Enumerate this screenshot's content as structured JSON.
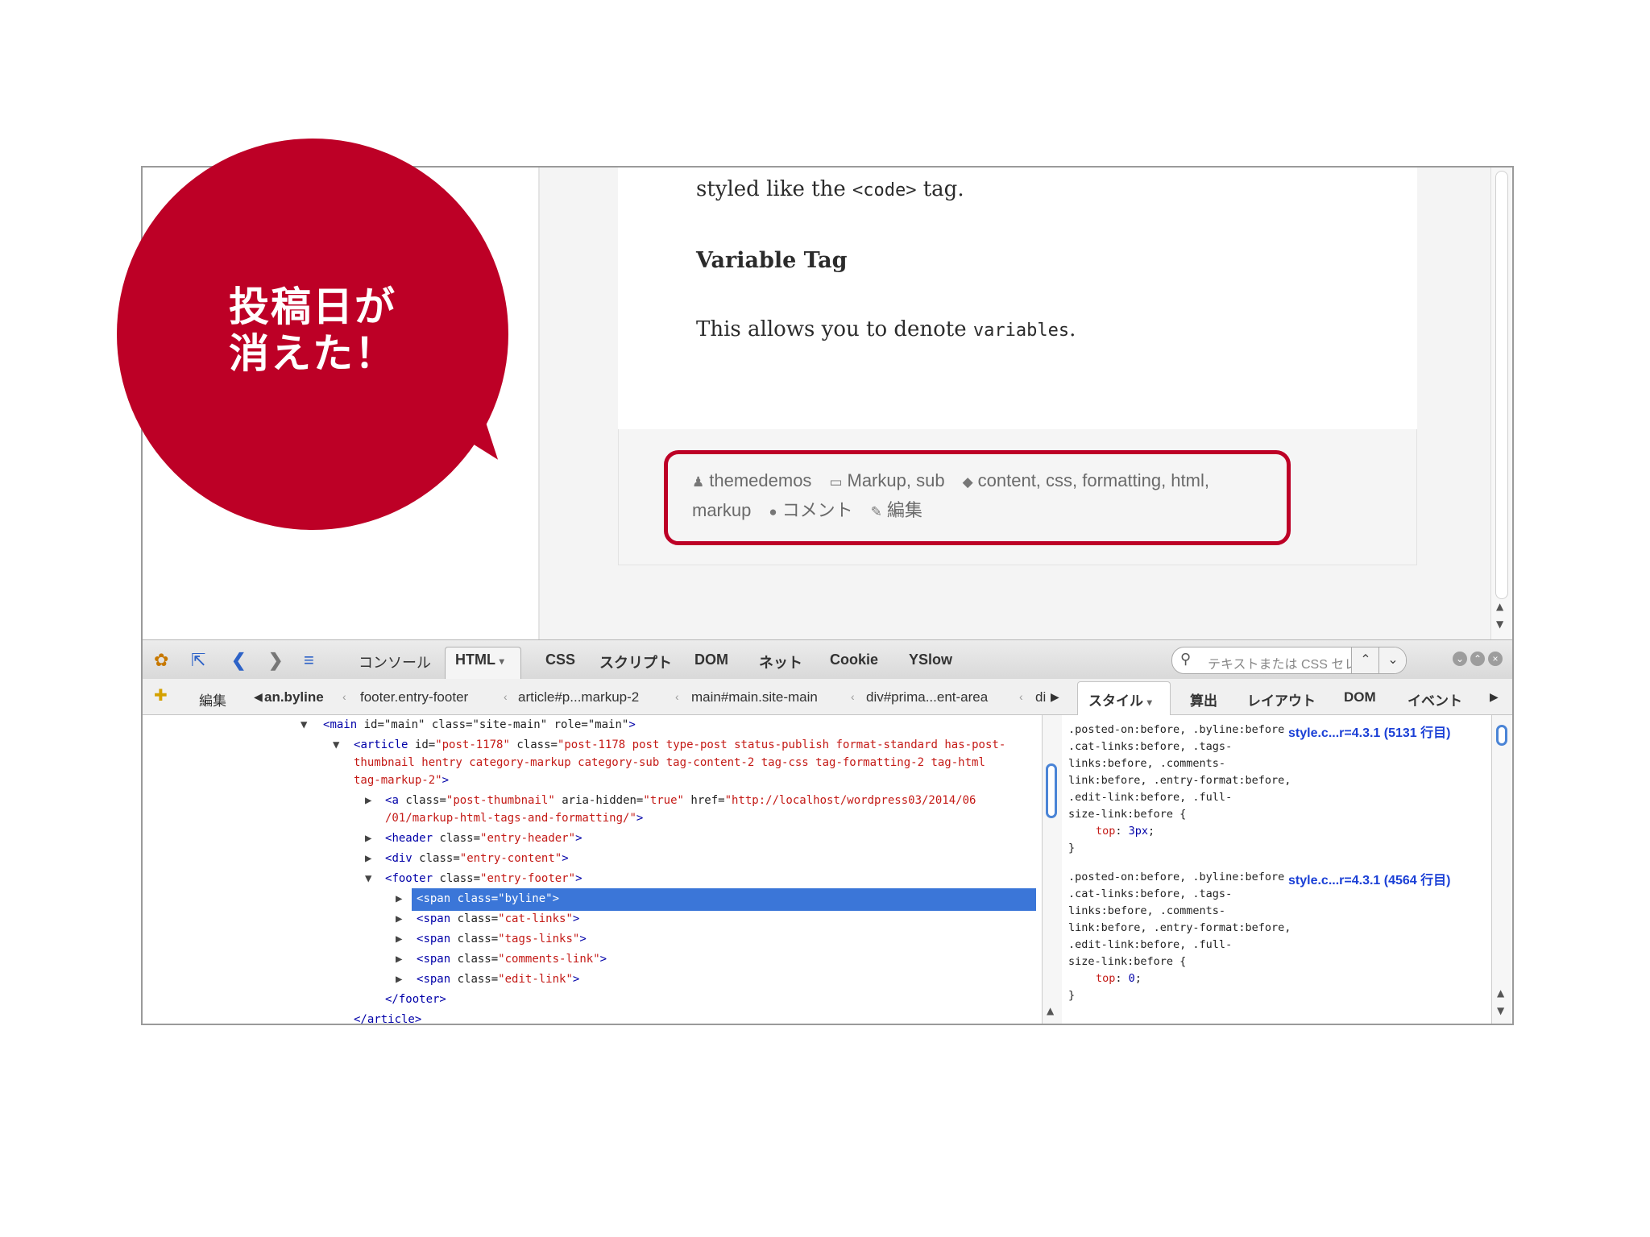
{
  "callout": {
    "line1": "投稿日が",
    "line2": "消えた！"
  },
  "page": {
    "para1_pre": "styled like the ",
    "para1_code": "<code>",
    "para1_post": " tag.",
    "heading": "Variable Tag",
    "para2_pre": "This allows you to denote ",
    "para2_code": "variables",
    "para2_post": ".",
    "meta": {
      "author": "themedemos",
      "categories": "Markup, sub",
      "tags_line1": "content, css, formatting, html,",
      "tags_line2": "markup",
      "comment": "コメント",
      "edit": "編集"
    }
  },
  "toolbar": {
    "tabs": [
      "コンソール",
      "HTML",
      "CSS",
      "スクリプト",
      "DOM",
      "ネット",
      "Cookie",
      "YSlow"
    ],
    "search_placeholder": "テキストまたは CSS セレクタ"
  },
  "breadcrumbs": {
    "edit": "編集",
    "items": [
      "an.byline",
      "footer.entry-footer",
      "article#p...markup-2",
      "main#main.site-main",
      "div#prima...ent-area",
      "di"
    ]
  },
  "side_tabs": [
    "スタイル",
    "算出",
    "レイアウト",
    "DOM",
    "イベント"
  ],
  "tree": [
    {
      "tag": "main",
      "attrs": "id=\"main\" class=\"site-main\" role=\"main\""
    },
    {
      "tag": "article",
      "id_val": "post-1178",
      "class_val_1": "post-1178 post type-post status-publish format-standard has-post-",
      "class_val_2": "thumbnail hentry category-markup category-sub tag-content-2 tag-css tag-formatting-2 tag-html",
      "class_val_3": "tag-markup-2"
    },
    {
      "tag": "a",
      "class_val": "post-thumbnail",
      "hidden_val": "true",
      "href_1": "http://localhost/wordpress03/2014/06",
      "href_2": "/01/markup-html-tags-and-formatting/"
    },
    {
      "tag": "header",
      "class_val": "entry-header"
    },
    {
      "tag": "div",
      "class_val": "entry-content"
    },
    {
      "tag": "footer",
      "class_val": "entry-footer"
    },
    {
      "tag": "span",
      "class_val": "byline"
    },
    {
      "tag": "span",
      "class_val": "cat-links"
    },
    {
      "tag": "span",
      "class_val": "tags-links"
    },
    {
      "tag": "span",
      "class_val": "comments-link"
    },
    {
      "tag": "span",
      "class_val": "edit-link"
    },
    {
      "close": "</footer>"
    },
    {
      "close": "</article>"
    }
  ],
  "css_rules": [
    {
      "lines": [
        ".posted-on:before, .byline:before",
        ".cat-links:before, .tags-",
        "links:before, .comments-",
        "link:before, .entry-format:before,",
        ".edit-link:before, .full-",
        "size-link:before {"
      ],
      "source": "style.c...r=4.3.1 (5131 行目)",
      "prop": "top",
      "value": "3px"
    },
    {
      "lines": [
        ".posted-on:before, .byline:before",
        ".cat-links:before, .tags-",
        "links:before, .comments-",
        "link:before, .entry-format:before,",
        ".edit-link:before, .full-",
        "size-link:before {"
      ],
      "source": "style.c...r=4.3.1 (4564 行目)",
      "prop": "top",
      "value": "0"
    }
  ],
  "colors": {
    "accent": "#bd0026",
    "selection": "#3b76d8",
    "link": "#1a3fd6"
  }
}
